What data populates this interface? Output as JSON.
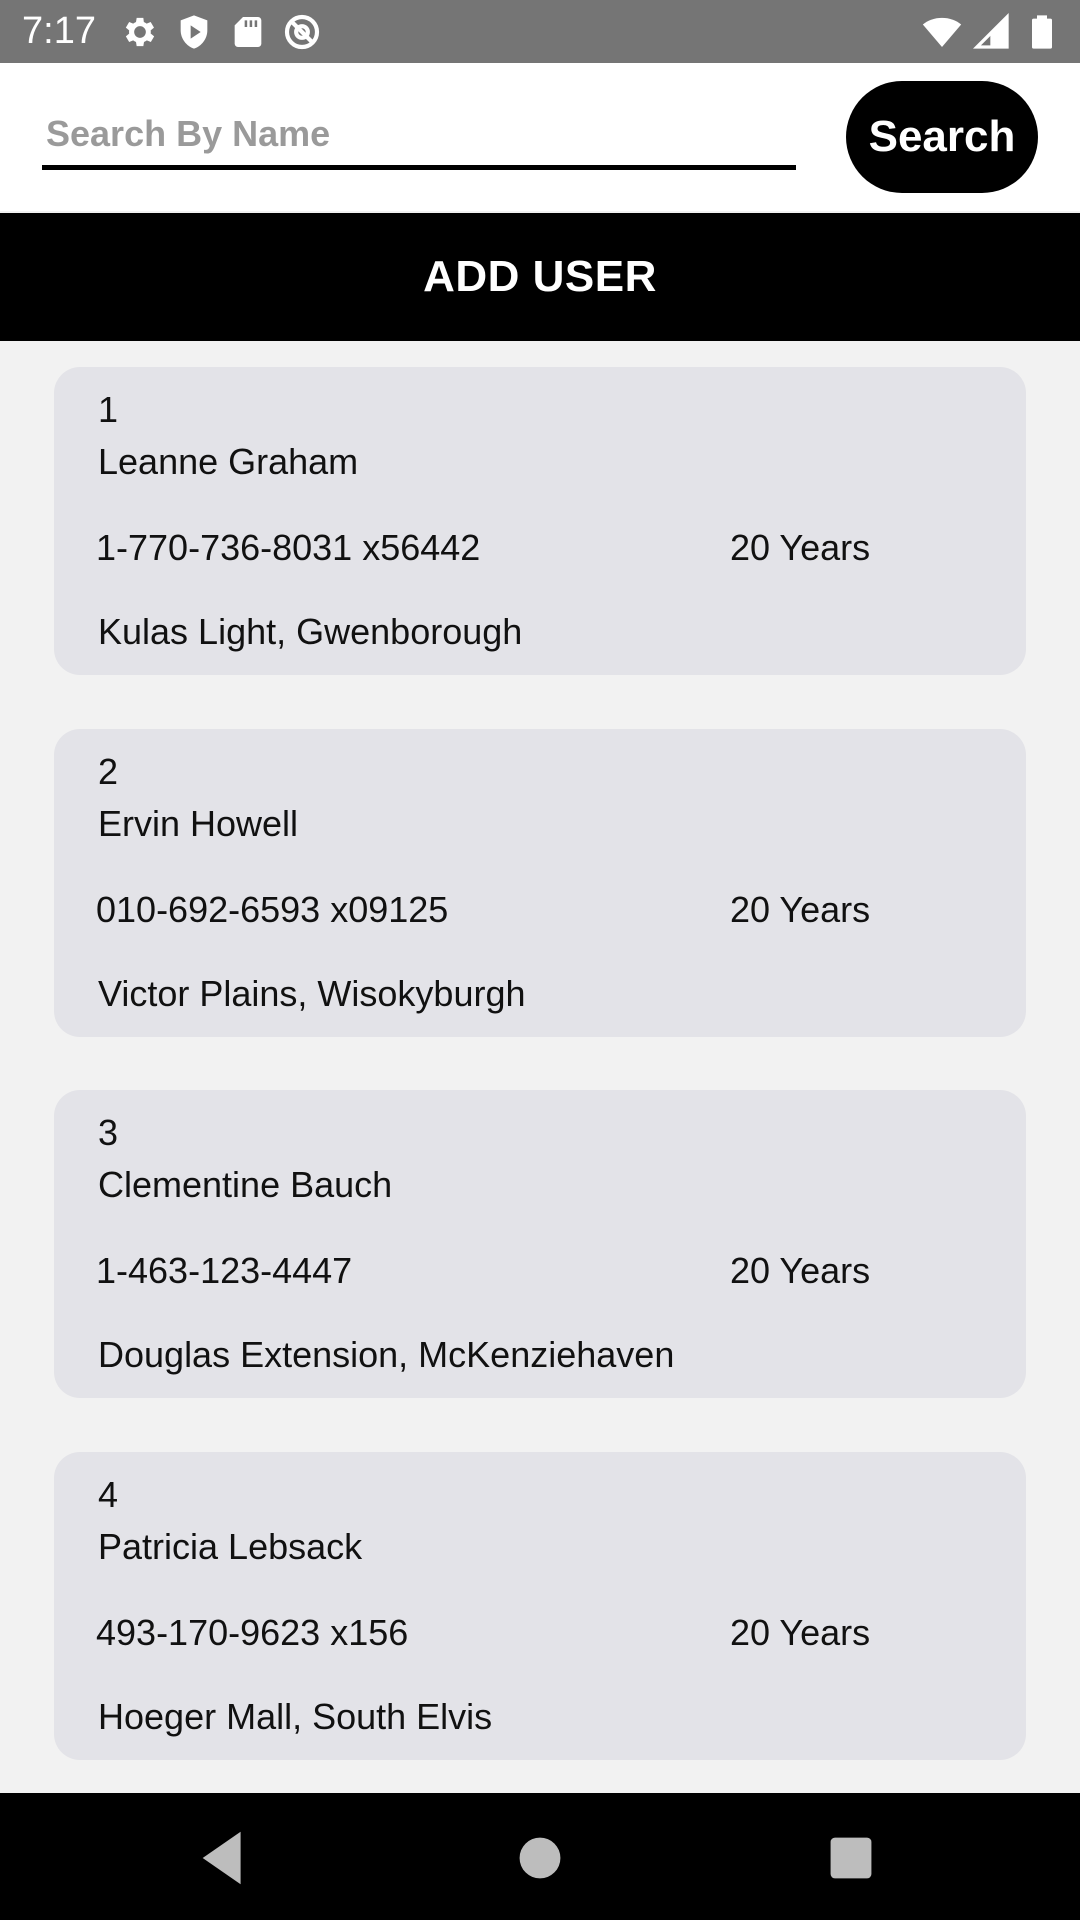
{
  "status_bar": {
    "time": "7:17",
    "icons_left": [
      "settings-icon",
      "shield-icon",
      "sd-card-icon",
      "at-sign-icon"
    ],
    "icons_right": [
      "wifi-icon",
      "signal-icon",
      "battery-icon"
    ]
  },
  "search": {
    "placeholder": "Search By Name",
    "value": "",
    "button_label": "Search"
  },
  "add_user": {
    "label": "ADD USER"
  },
  "users": [
    {
      "id": "1",
      "name": "Leanne Graham",
      "phone": "1-770-736-8031 x56442",
      "age": "20 Years",
      "address": "Kulas Light, Gwenborough"
    },
    {
      "id": "2",
      "name": "Ervin Howell",
      "phone": "010-692-6593 x09125",
      "age": "20 Years",
      "address": "Victor Plains, Wisokyburgh"
    },
    {
      "id": "3",
      "name": "Clementine Bauch",
      "phone": "1-463-123-4447",
      "age": "20 Years",
      "address": "Douglas Extension, McKenziehaven"
    },
    {
      "id": "4",
      "name": "Patricia Lebsack",
      "phone": "493-170-9623 x156",
      "age": "20 Years",
      "address": "Hoeger Mall, South Elvis"
    }
  ],
  "nav_bar": {
    "buttons": [
      "back-icon",
      "home-icon",
      "recents-icon"
    ]
  },
  "colors": {
    "accent": "#000000",
    "card_bg": "#e3e3e8",
    "status_bar": "#757575",
    "page_bg": "#f2f2f2"
  }
}
